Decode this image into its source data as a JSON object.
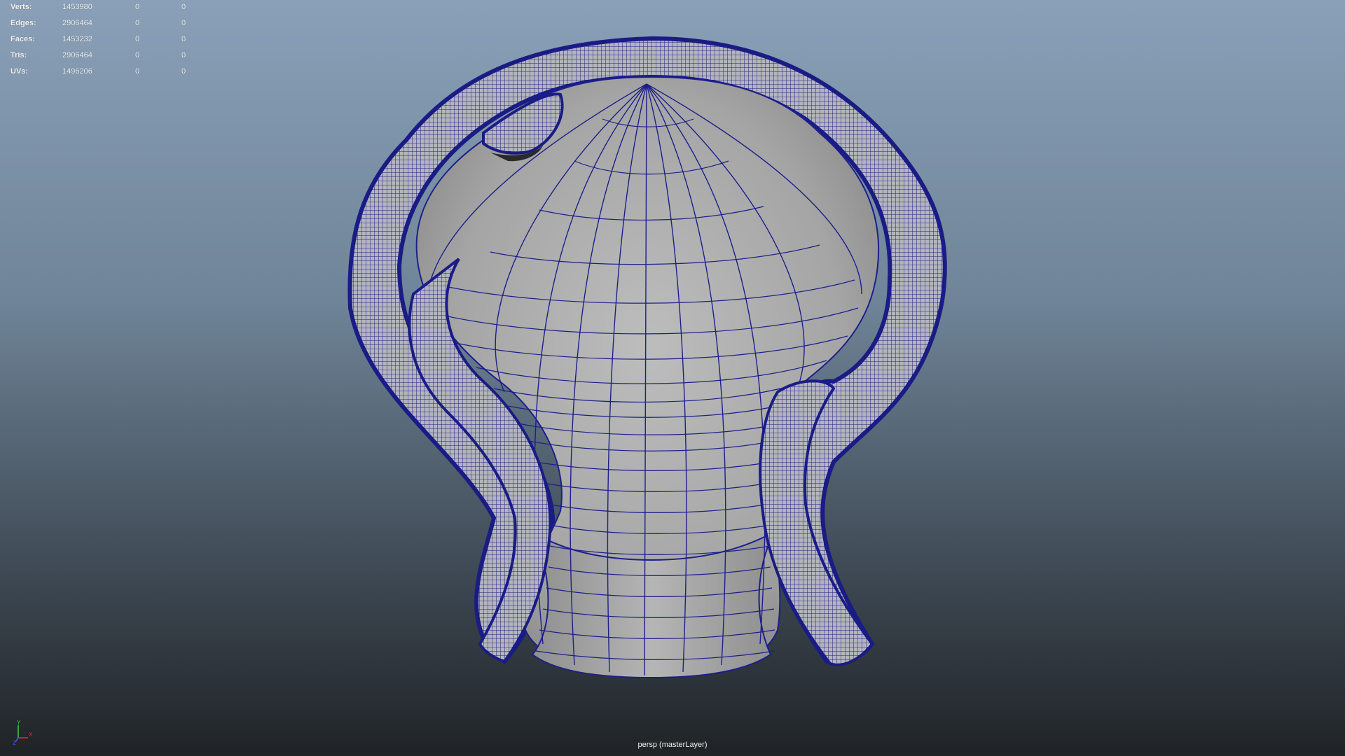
{
  "hud": {
    "rows": [
      {
        "label": "Verts:",
        "total": "1453980",
        "selected": "0",
        "component": "0"
      },
      {
        "label": "Edges:",
        "total": "2906464",
        "selected": "0",
        "component": "0"
      },
      {
        "label": "Faces:",
        "total": "1453232",
        "selected": "0",
        "component": "0"
      },
      {
        "label": "Tris:",
        "total": "2906464",
        "selected": "0",
        "component": "0"
      },
      {
        "label": "UVs:",
        "total": "1496206",
        "selected": "0",
        "component": "0"
      }
    ]
  },
  "camera_label": "persp (masterLayer)",
  "axis": {
    "y": "Y",
    "x": "X",
    "z": "Z"
  },
  "colors": {
    "wire": "#1d1f8a",
    "surface": "#a9a9a9",
    "bg_top": "#8aa0b8",
    "bg_bottom": "#1f2326"
  }
}
